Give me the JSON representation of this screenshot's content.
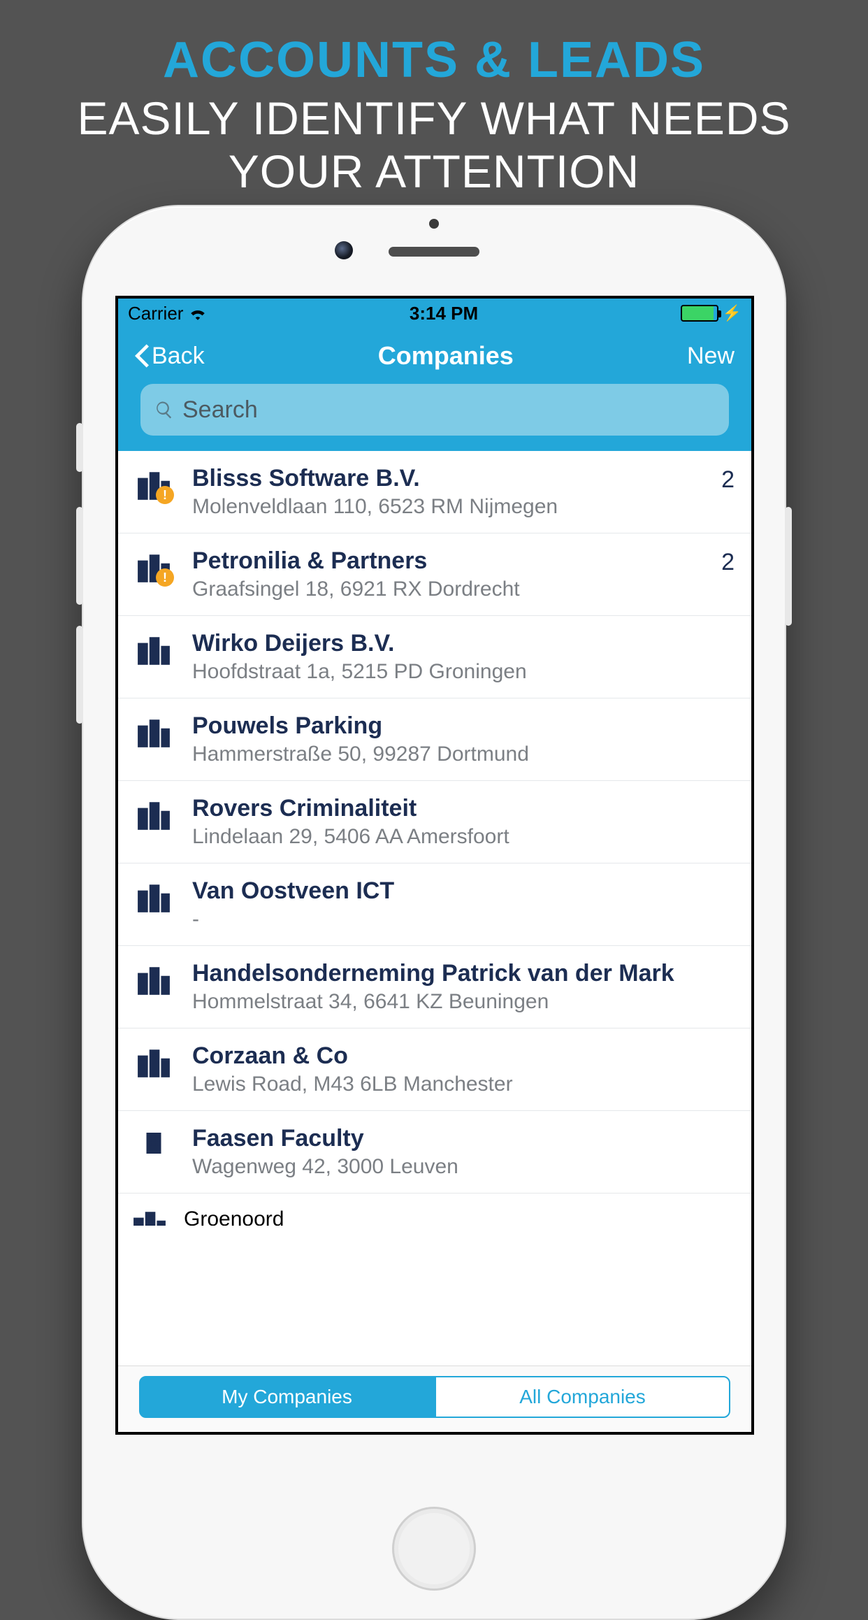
{
  "promo": {
    "title": "ACCOUNTS & LEADS",
    "subtitle_line1": "EASILY IDENTIFY WHAT NEEDS",
    "subtitle_line2": "YOUR ATTENTION"
  },
  "statusbar": {
    "carrier": "Carrier",
    "time": "3:14 PM"
  },
  "navbar": {
    "back": "Back",
    "title": "Companies",
    "new": "New"
  },
  "search": {
    "placeholder": "Search"
  },
  "companies": [
    {
      "name": "Blisss Software B.V.",
      "address": "Molenveldlaan 110, 6523 RM Nijmegen",
      "badge": "2",
      "alert": true,
      "type": "complex"
    },
    {
      "name": "Petronilia & Partners",
      "address": "Graafsingel 18, 6921 RX Dordrecht",
      "badge": "2",
      "alert": true,
      "type": "complex"
    },
    {
      "name": "Wirko Deijers B.V.",
      "address": "Hoofdstraat 1a, 5215 PD Groningen",
      "badge": "",
      "alert": false,
      "type": "complex"
    },
    {
      "name": "Pouwels Parking",
      "address": "Hammerstraße 50, 99287 Dortmund",
      "badge": "",
      "alert": false,
      "type": "complex"
    },
    {
      "name": "Rovers Criminaliteit",
      "address": "Lindelaan 29, 5406 AA Amersfoort",
      "badge": "",
      "alert": false,
      "type": "complex"
    },
    {
      "name": "Van Oostveen ICT",
      "address": "-",
      "badge": "",
      "alert": false,
      "type": "complex"
    },
    {
      "name": "Handelsonderneming Patrick van der Mark",
      "address": "Hommelstraat 34, 6641 KZ Beuningen",
      "badge": "",
      "alert": false,
      "type": "complex"
    },
    {
      "name": "Corzaan & Co",
      "address": "Lewis Road, M43 6LB Manchester",
      "badge": "",
      "alert": false,
      "type": "complex"
    },
    {
      "name": "Faasen Faculty",
      "address": "Wagenweg 42, 3000 Leuven",
      "badge": "",
      "alert": false,
      "type": "single"
    }
  ],
  "partial_company": {
    "name": "Groenoord"
  },
  "tabs": {
    "my": "My Companies",
    "all": "All Companies"
  }
}
